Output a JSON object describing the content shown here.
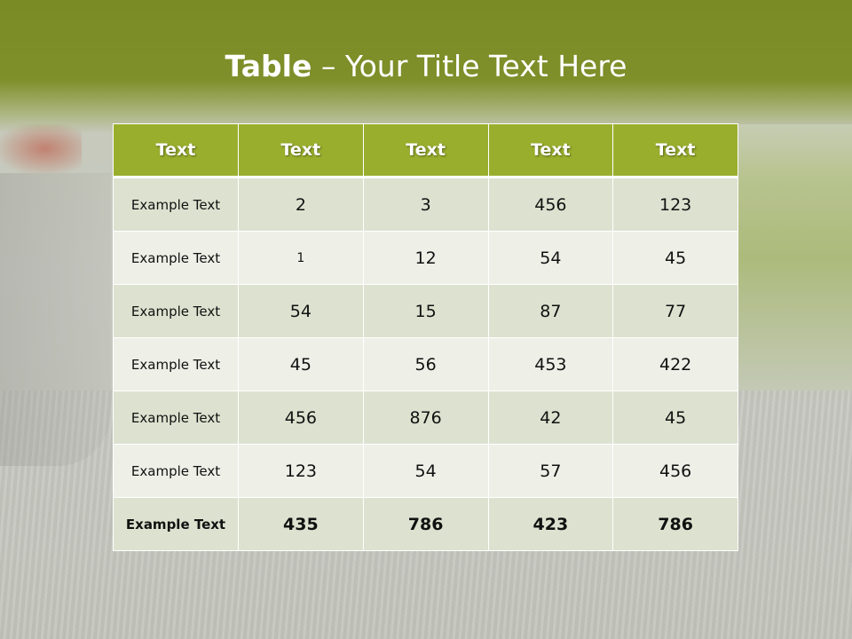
{
  "slide": {
    "title_bold": "Table",
    "title_rest": " – Your Title Text Here"
  },
  "table": {
    "headers": [
      "Text",
      "Text",
      "Text",
      "Text",
      "Text"
    ],
    "rows": [
      [
        "Example Text",
        "2",
        "3",
        "456",
        "123"
      ],
      [
        "Example Text",
        "1",
        "12",
        "54",
        "45"
      ],
      [
        "Example Text",
        "54",
        "15",
        "87",
        "77"
      ],
      [
        "Example Text",
        "45",
        "56",
        "453",
        "422"
      ],
      [
        "Example Text",
        "456",
        "876",
        "42",
        "45"
      ],
      [
        "Example Text",
        "123",
        "54",
        "57",
        "456"
      ],
      [
        "Example Text",
        "435",
        "786",
        "423",
        "786"
      ]
    ]
  },
  "colors": {
    "header_band": "#7a8a24",
    "table_header": "#9aae2d",
    "row_odd": "#dde2d0",
    "row_even": "#eeefe7"
  }
}
